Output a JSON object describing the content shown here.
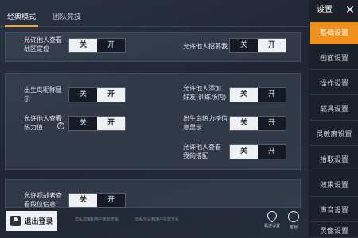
{
  "tabs": [
    {
      "label": "经典模式",
      "active": true
    },
    {
      "label": "团队竞技",
      "active": false
    }
  ],
  "settings": [
    {
      "label": "允许他人查看\n战区定位",
      "off": "关",
      "on": "开",
      "selected": "off"
    },
    {
      "label": "允许他人招募我",
      "off": "关",
      "on": "开",
      "selected": "on"
    },
    {
      "label": "出生岛昵称显\n示",
      "off": "关",
      "on": "开",
      "selected": "on"
    },
    {
      "label": "允许他人添加\n好友(训练场内)",
      "off": "关",
      "on": "开",
      "selected": "off"
    },
    {
      "label": "允许他人查看\n热力值",
      "off": "关",
      "on": "开",
      "selected": "on"
    },
    {
      "label": "出生岛热力榜信\n息显示",
      "off": "关",
      "on": "开",
      "selected": "off"
    },
    {
      "label": "允许他人查看\n我的搭配",
      "off": "关",
      "on": "开",
      "selected": "off"
    },
    {
      "label": "允许观战者查\n看段位信息",
      "off": "关",
      "on": "开",
      "selected": "off"
    }
  ],
  "help_icon": "question-circle-icon",
  "sidebar": {
    "title": "设置",
    "close": "✕",
    "items": [
      {
        "label": "基础设置",
        "active": true
      },
      {
        "label": "画面设置",
        "active": false
      },
      {
        "label": "操作设置",
        "active": false
      },
      {
        "label": "载具设置",
        "active": false
      },
      {
        "label": "灵敏度设置",
        "active": false
      },
      {
        "label": "拾取设置",
        "active": false
      },
      {
        "label": "效果设置",
        "active": false
      },
      {
        "label": "声音设置",
        "active": false
      },
      {
        "label": "灵像设置",
        "active": false
      }
    ]
  },
  "footer": {
    "logout_label": "退出登录",
    "note_left": "隐私政策和用户条款查看",
    "note_right": "隐私协议和用户条款查看",
    "icons": [
      {
        "label": "机游设置",
        "icon": "location-pin-icon"
      },
      {
        "label": "客服",
        "icon": "headset-icon"
      }
    ]
  },
  "colors": {
    "accent": "#ef8f1c",
    "tab_underline": "#f1a635",
    "toggle_selected": "#eef0f4",
    "toggle_unselected": "#151a24"
  }
}
